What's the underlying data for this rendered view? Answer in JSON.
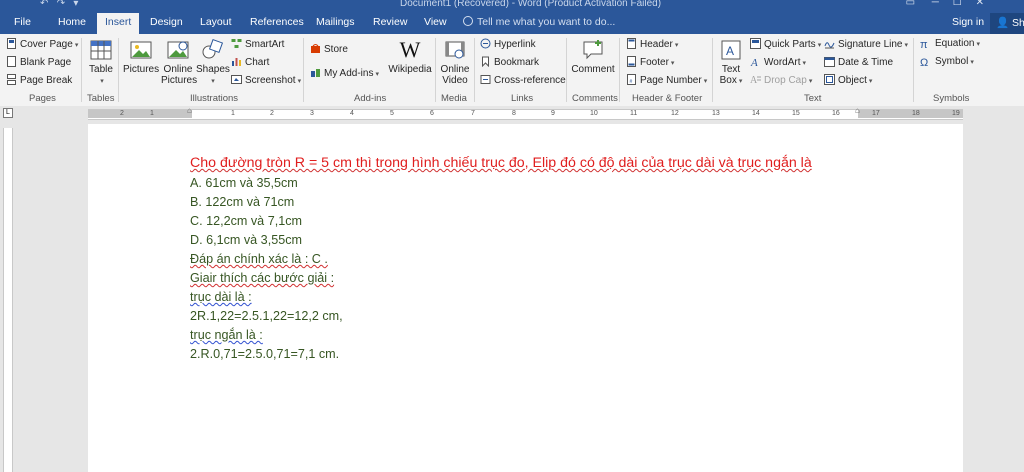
{
  "window": {
    "title": "Document1 (Recovered) - Word (Product Activation Failed)"
  },
  "tabs": [
    "File",
    "Home",
    "Insert",
    "Design",
    "Layout",
    "References",
    "Mailings",
    "Review",
    "View"
  ],
  "active_tab": "Insert",
  "tellme_placeholder": "Tell me what you want to do...",
  "signin_label": "Sign in",
  "share_label": "Shar",
  "ribbon": {
    "pages": {
      "cover_page": "Cover Page",
      "blank_page": "Blank Page",
      "page_break": "Page Break",
      "label": "Pages"
    },
    "tables": {
      "table": "Table",
      "label": "Tables"
    },
    "illustrations": {
      "pictures": "Pictures",
      "online_pictures_1": "Online",
      "online_pictures_2": "Pictures",
      "shapes": "Shapes",
      "smartart": "SmartArt",
      "chart": "Chart",
      "screenshot": "Screenshot",
      "label": "Illustrations"
    },
    "addins": {
      "store": "Store",
      "my_addins": "My Add-ins",
      "wikipedia": "Wikipedia",
      "label": "Add-ins"
    },
    "media": {
      "online_video_1": "Online",
      "online_video_2": "Video",
      "label": "Media"
    },
    "links": {
      "hyperlink": "Hyperlink",
      "bookmark": "Bookmark",
      "cross_reference": "Cross-reference",
      "label": "Links"
    },
    "comments": {
      "comment": "Comment",
      "label": "Comments"
    },
    "header_footer": {
      "header": "Header",
      "footer": "Footer",
      "page_number": "Page Number",
      "label": "Header & Footer"
    },
    "text": {
      "text_box_1": "Text",
      "text_box_2": "Box",
      "quick_parts": "Quick Parts",
      "wordart": "WordArt",
      "drop_cap": "Drop Cap",
      "signature_line": "Signature Line",
      "date_time": "Date & Time",
      "object": "Object",
      "label": "Text"
    },
    "symbols": {
      "equation": "Equation",
      "symbol": "Symbol",
      "label": "Symbols"
    }
  },
  "ruler_numbers": [
    "2",
    "1",
    "1",
    "2",
    "3",
    "4",
    "5",
    "6",
    "7",
    "8",
    "9",
    "10",
    "11",
    "12",
    "13",
    "14",
    "15",
    "16",
    "17",
    "18",
    "19"
  ],
  "document": {
    "question": "Cho đường tròn R = 5 cm thì trong hình chiếu trục đo, Elip đó có độ dài của trục dài và trục ngắn là",
    "option_a": "A. 61cm và 35,5cm",
    "option_b": "B. 122cm và 71cm",
    "option_c": "C. 12,2cm và 7,1cm",
    "option_d": "D. 6,1cm và 3,55cm",
    "answer": "Đáp án chính xác là : C .",
    "explain": "Giair thích các bước giải :",
    "major_label": "trục dài là :",
    "major_calc": "2R.1,22=2.5.1,22=12,2 cm,",
    "minor_label": "trục ngắn là :",
    "minor_calc": "2.R.0,71=2.5.0,71=7,1 cm."
  }
}
